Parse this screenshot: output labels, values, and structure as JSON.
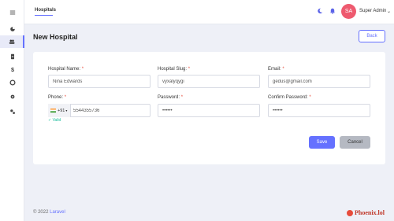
{
  "header": {
    "tab": "Hospitals",
    "user": {
      "initials": "SA",
      "name": "Super Admin"
    }
  },
  "page": {
    "title": "New Hospital",
    "back_label": "Back"
  },
  "form": {
    "hospital_name": {
      "label": "Hospital Name:",
      "value": "Nina Edwards"
    },
    "hospital_slug": {
      "label": "Hospital Slug:",
      "value": "vyxalyqygi"
    },
    "email": {
      "label": "Email:",
      "value": "gedus@gmail.com"
    },
    "phone": {
      "label": "Phone:",
      "country_code": "+91",
      "value": "5544355736",
      "valid_text": "✓ Valid"
    },
    "password": {
      "label": "Password:",
      "value": "••••••"
    },
    "confirm_password": {
      "label": "Confirm Password:",
      "value": "••••••"
    },
    "required_mark": "*"
  },
  "actions": {
    "save_label": "Save",
    "cancel_label": "Cancel"
  },
  "footer": {
    "copyright": "© 2022",
    "link": "Laravel"
  },
  "brand": {
    "name": "Phoenix.lol"
  },
  "colors": {
    "accent": "#6571ff",
    "avatar": "#ee5a6f",
    "valid": "#1abc9c",
    "required": "#e74c3c"
  }
}
